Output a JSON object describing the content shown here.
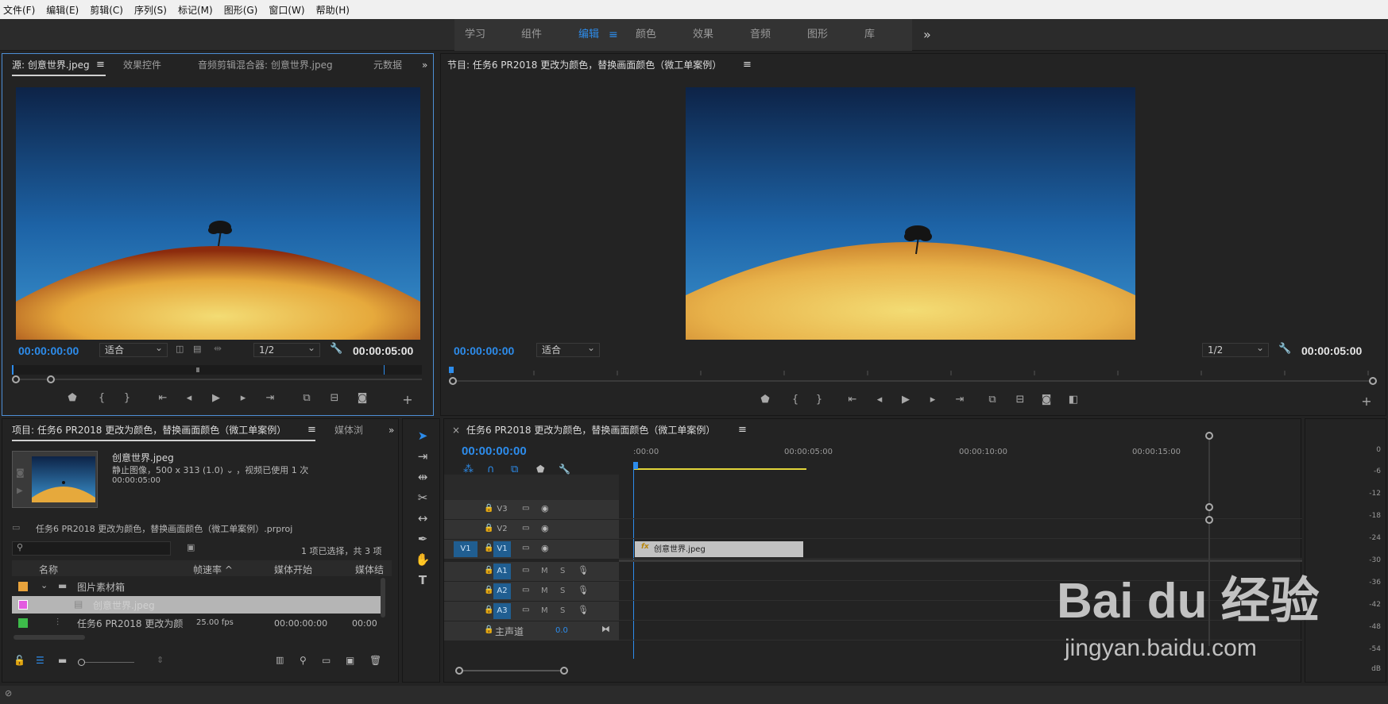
{
  "menu": [
    "文件(F)",
    "编辑(E)",
    "剪辑(C)",
    "序列(S)",
    "标记(M)",
    "图形(G)",
    "窗口(W)",
    "帮助(H)"
  ],
  "workspaces": [
    "学习",
    "组件",
    "编辑",
    "颜色",
    "效果",
    "音频",
    "图形",
    "库"
  ],
  "workspace_active": "编辑",
  "source": {
    "tabs": [
      "源: 创意世界.jpeg",
      "效果控件",
      "音频剪辑混合器: 创意世界.jpeg",
      "元数据"
    ],
    "timecode_in": "00:00:00:00",
    "fit": "适合",
    "resolution": "1/2",
    "timecode_out": "00:00:05:00"
  },
  "program": {
    "title": "节目: 任务6 PR2018 更改为颜色，替换画面颜色（微工单案例）",
    "timecode_in": "00:00:00:00",
    "fit": "适合",
    "resolution": "1/2",
    "timecode_out": "00:00:05:00"
  },
  "project": {
    "tabs": [
      "项目: 任务6 PR2018 更改为颜色，替换画面颜色（微工单案例）",
      "媒体浏"
    ],
    "clip_name": "创意世界.jpeg",
    "clip_type": "静止图像，500 x 313 (1.0) ⌄ ，视频已使用 1 次",
    "clip_duration": "00:00:05:00",
    "project_file": "任务6 PR2018 更改为颜色，替换画面颜色（微工单案例）.prproj",
    "selection_count": "1 项已选择，共 3 项",
    "columns": [
      "名称",
      "帧速率 ^",
      "媒体开始",
      "媒体结"
    ],
    "rows": [
      {
        "color": "#e8a33c",
        "name": "图片素材箱",
        "fps": "",
        "start": "",
        "end": ""
      },
      {
        "color": "#e35be0",
        "name": "创意世界.jpeg",
        "fps": "",
        "start": "",
        "end": ""
      },
      {
        "color": "#3dbb4a",
        "name": "任务6 PR2018 更改为颜",
        "fps": "25.00 fps",
        "start": "00:00:00:00",
        "end": "00:00"
      }
    ]
  },
  "timeline": {
    "title": "任务6 PR2018 更改为颜色，替换画面颜色（微工单案例）",
    "timecode": "00:00:00:00",
    "ruler": [
      ":00:00",
      "00:00:05:00",
      "00:00:10:00",
      "00:00:15:00"
    ],
    "video_tracks": [
      "V3",
      "V2",
      "V1"
    ],
    "audio_tracks": [
      "A1",
      "A2",
      "A3"
    ],
    "source_patch": "V1",
    "master_label": "主声道",
    "master_value": "0.0",
    "clip_label": "创意世界.jpeg",
    "fx_badge": "fx",
    "mute": "M",
    "solo": "S"
  },
  "meter_scale": [
    "0",
    "-6",
    "-12",
    "-18",
    "-24",
    "-30",
    "-36",
    "-42",
    "-48",
    "-54",
    "dB"
  ],
  "watermark": {
    "brand": "Bai du 经验",
    "url": "jingyan.baidu.com"
  }
}
